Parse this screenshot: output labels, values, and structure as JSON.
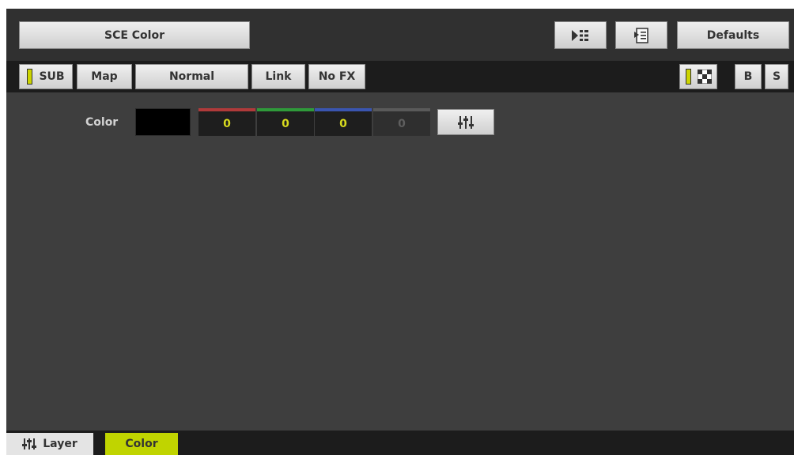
{
  "header": {
    "title_button": "SCE Color",
    "defaults_button": "Defaults",
    "icons": [
      "play-next-icon",
      "playlist-icon"
    ]
  },
  "toolbar": {
    "sub": "SUB",
    "map": "Map",
    "blend": "Normal",
    "link": "Link",
    "fx": "No FX",
    "b": "B",
    "s": "S",
    "icons": [
      "checker-icon"
    ]
  },
  "content": {
    "color_label": "Color",
    "channels": [
      {
        "value": "0",
        "color": "#b03a3a"
      },
      {
        "value": "0",
        "color": "#2f9a3a"
      },
      {
        "value": "0",
        "color": "#3a55b0"
      },
      {
        "value": "0",
        "color": "#5a5a5a"
      }
    ],
    "swatch_color": "#000000",
    "icons": [
      "mixer-icon"
    ]
  },
  "tabs": {
    "layer": "Layer",
    "color": "Color",
    "active_color": "#c0d400"
  }
}
